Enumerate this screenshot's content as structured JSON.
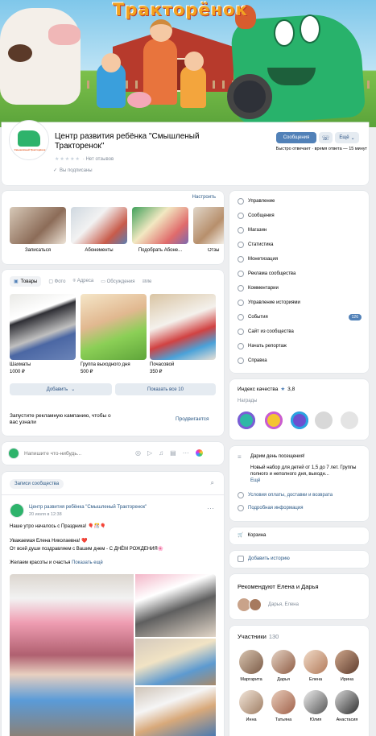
{
  "cover": {
    "logo_text": "Тракторёнок"
  },
  "header": {
    "title": "Центр развития ребёнка \"Смышленый Тракторенок\"",
    "no_reviews": "Нет отзывов",
    "subscribed": "Вы подписаны",
    "message_btn": "Сообщения",
    "more_btn": "Ещё",
    "response_time": "Быстро отвечает · время ответа — 15 минут",
    "logo_label": "Смышлёный Тракторёнок"
  },
  "services": {
    "configure": "Настроить",
    "items": [
      {
        "label": "Записаться"
      },
      {
        "label": "Абонементы"
      },
      {
        "label": "Подобрать Абоне..."
      },
      {
        "label": "Отзы"
      }
    ]
  },
  "goods": {
    "tabs": [
      "Товары",
      "Фото",
      "Адреса",
      "Обсуждения",
      "Ме"
    ],
    "items": [
      {
        "name": "Шахматы",
        "price": "1000 ₽"
      },
      {
        "name": "Группа выходного дня",
        "price": "500 ₽"
      },
      {
        "name": "Почасовой",
        "price": "350 ₽"
      }
    ],
    "add": "Добавить",
    "show_all": "Показать все 10",
    "ad_text": "Запустите рекламную кампанию, чтобы о вас узнали",
    "promote": "Продвигается"
  },
  "composer": {
    "placeholder": "Напишите что-нибудь..."
  },
  "wall": {
    "filter": "Записи сообщества",
    "post": {
      "author": "Центр развития ребёнка \"Смышленый Тракторенок\"",
      "date": "20 июля в 12:38",
      "lines": [
        "Наше утро началось с Праздника! 🎈🎊🎈",
        "Уважаемая Елена Николаевна! ❤️",
        "От всей души поздравляем с Вашим днем - С ДНЁМ РОЖДЕНИЯ🌸",
        "Желаем красоты и счастья"
      ],
      "show_more": "Показать ещё"
    }
  },
  "menu": {
    "items": [
      {
        "label": "Управление",
        "icon": "gear-icon"
      },
      {
        "label": "Сообщения",
        "icon": "message-icon"
      },
      {
        "label": "Магазин",
        "icon": "shop-icon"
      },
      {
        "label": "Статистика",
        "icon": "stats-icon"
      },
      {
        "label": "Монетизация",
        "icon": "money-icon"
      },
      {
        "label": "Реклама сообщества",
        "icon": "ad-icon"
      },
      {
        "label": "Комментарии",
        "icon": "comment-icon"
      },
      {
        "label": "Управление историями",
        "icon": "stories-icon"
      },
      {
        "label": "События",
        "icon": "events-icon",
        "badge": "126"
      },
      {
        "label": "Сайт из сообщества",
        "icon": "site-icon"
      },
      {
        "label": "Начать репортаж",
        "icon": "live-icon"
      },
      {
        "label": "Справка",
        "icon": "help-icon"
      }
    ]
  },
  "quality": {
    "title": "Индекс качества",
    "score": "3,8",
    "awards": "Награды"
  },
  "info": {
    "donation": "Дарим день посещения!",
    "text": "Новый набор для детей от 1,5 до 7 лет. Группы полного и неполного дня, выходн...",
    "more": "Ещё",
    "payment": "Условия оплаты, доставки и возврата",
    "details": "Подробная информация"
  },
  "cart": "Корзина",
  "add_story": "Добавить историю",
  "recommend": {
    "title": "Рекомендуют Елена и Дарья",
    "names": "Дарья, Елена"
  },
  "members": {
    "title": "Участники",
    "count": "130",
    "list": [
      "Маргарита",
      "Дарья",
      "Елена",
      "Ирина",
      "Инна",
      "Татьяна",
      "Юлия",
      "Анастасия"
    ]
  },
  "colors": {
    "accent": "#5181b8",
    "badge": "#5181b8"
  }
}
